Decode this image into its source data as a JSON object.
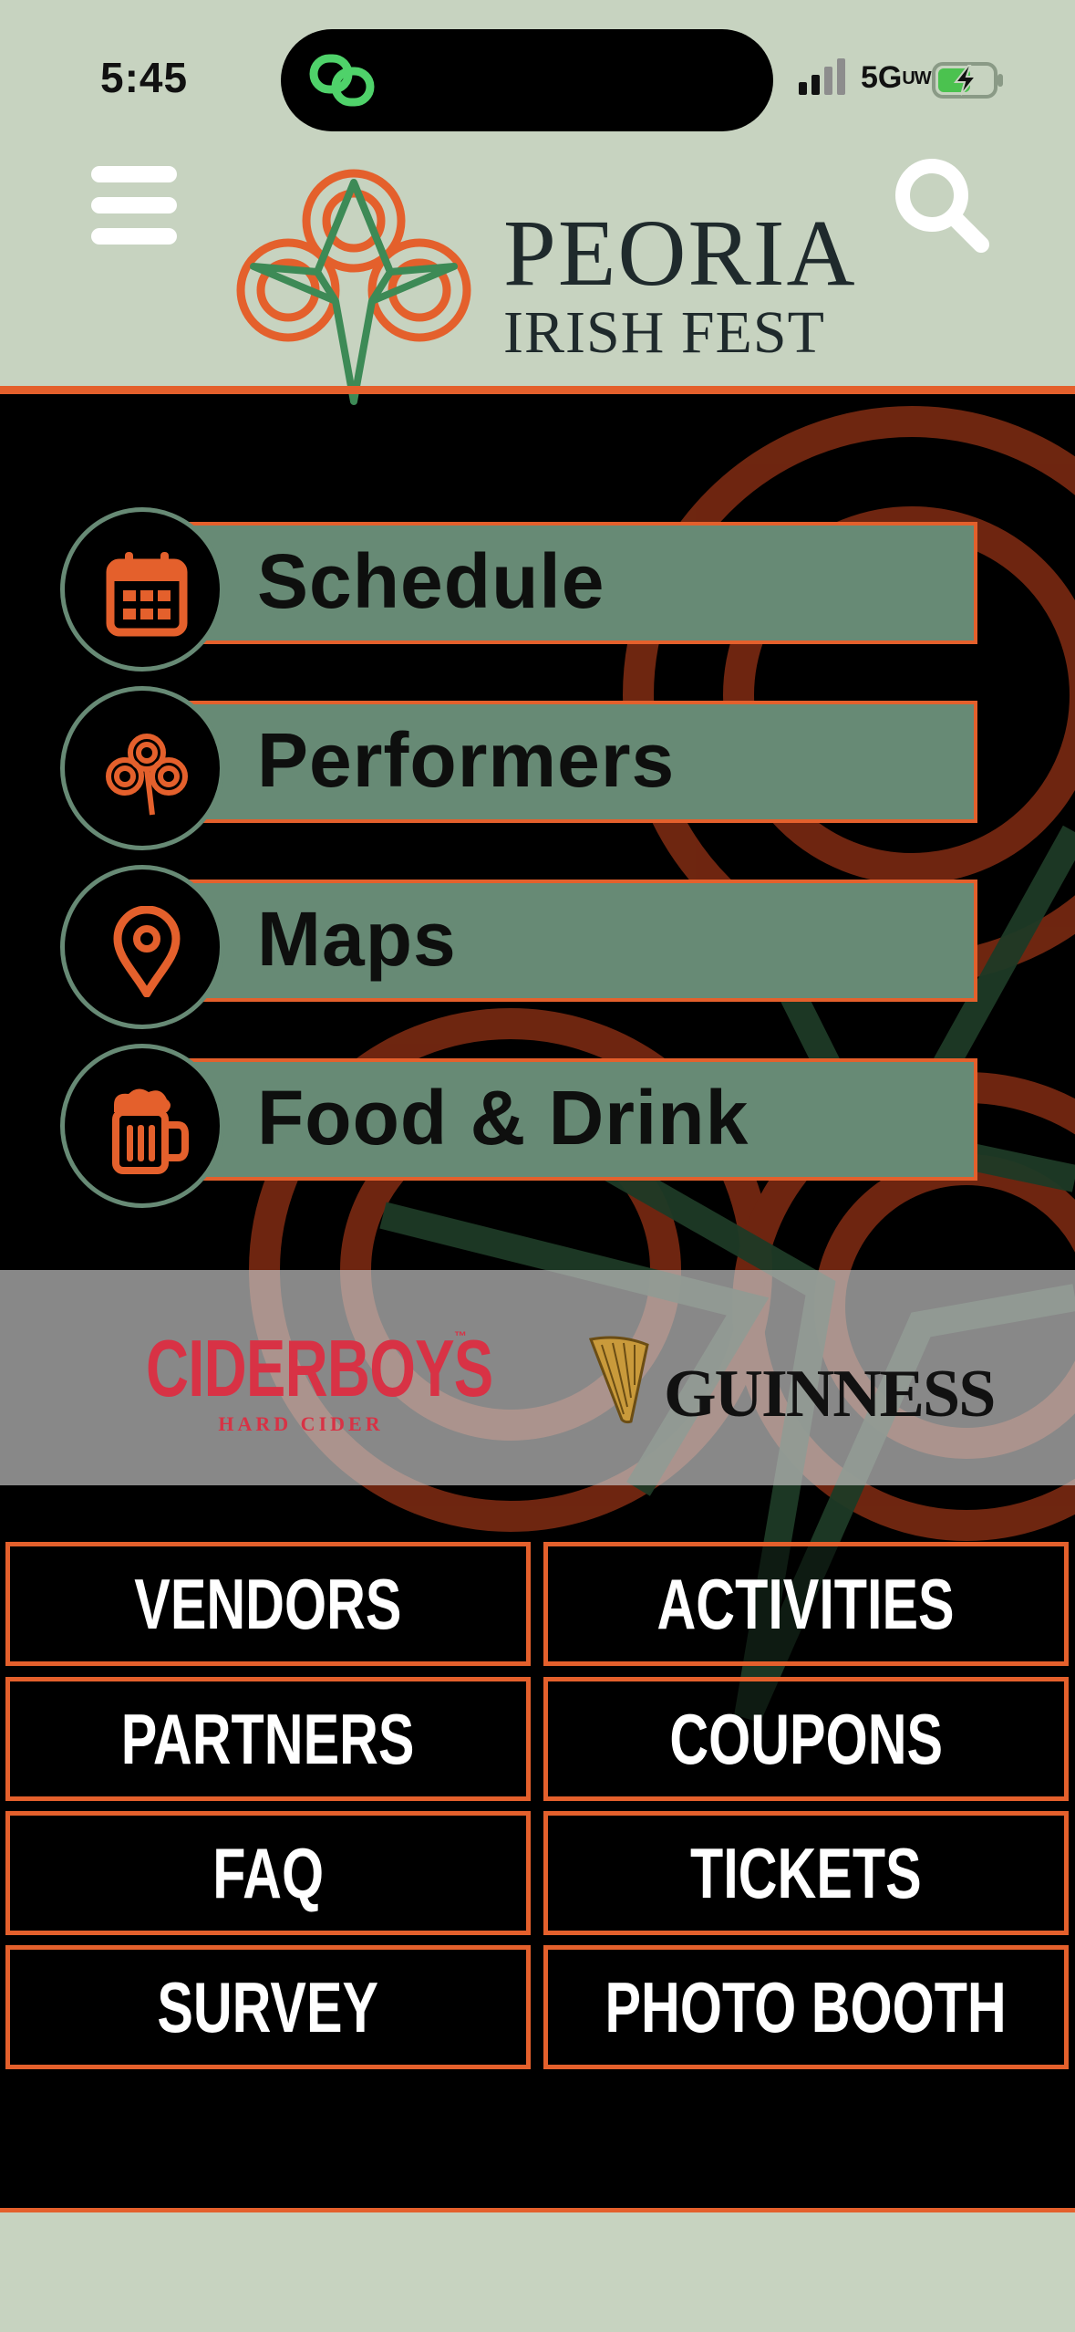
{
  "status_bar": {
    "time": "5:45",
    "network": "5G",
    "network_sup": "UW",
    "battery_level": 0.6
  },
  "header": {
    "brand_line1": "PEORIA",
    "brand_line2": "IRISH FEST",
    "menu_icon": "hamburger-menu-icon",
    "search_icon": "search-icon"
  },
  "primary_menu": [
    {
      "label": "Schedule",
      "icon": "calendar-icon"
    },
    {
      "label": "Performers",
      "icon": "shamrock-icon"
    },
    {
      "label": "Maps",
      "icon": "map-pin-icon"
    },
    {
      "label": "Food & Drink",
      "icon": "beer-mug-icon"
    }
  ],
  "sponsors": {
    "cider_name": "CIDERBOYS",
    "cider_sub": "HARD CIDER",
    "cider_tm": "™",
    "guinness_name": "GUINNESS"
  },
  "grid_menu": [
    "VENDORS",
    "ACTIVITIES",
    "PARTNERS",
    "COUPONS",
    "FAQ",
    "TICKETS",
    "SURVEY",
    "PHOTO BOOTH"
  ],
  "colors": {
    "header_bg": "#c7d3c0",
    "accent_orange": "#e4602c",
    "sage": "#678a75",
    "shamrock_green": "#3d8a56",
    "ciderboys_red": "#d83245"
  }
}
